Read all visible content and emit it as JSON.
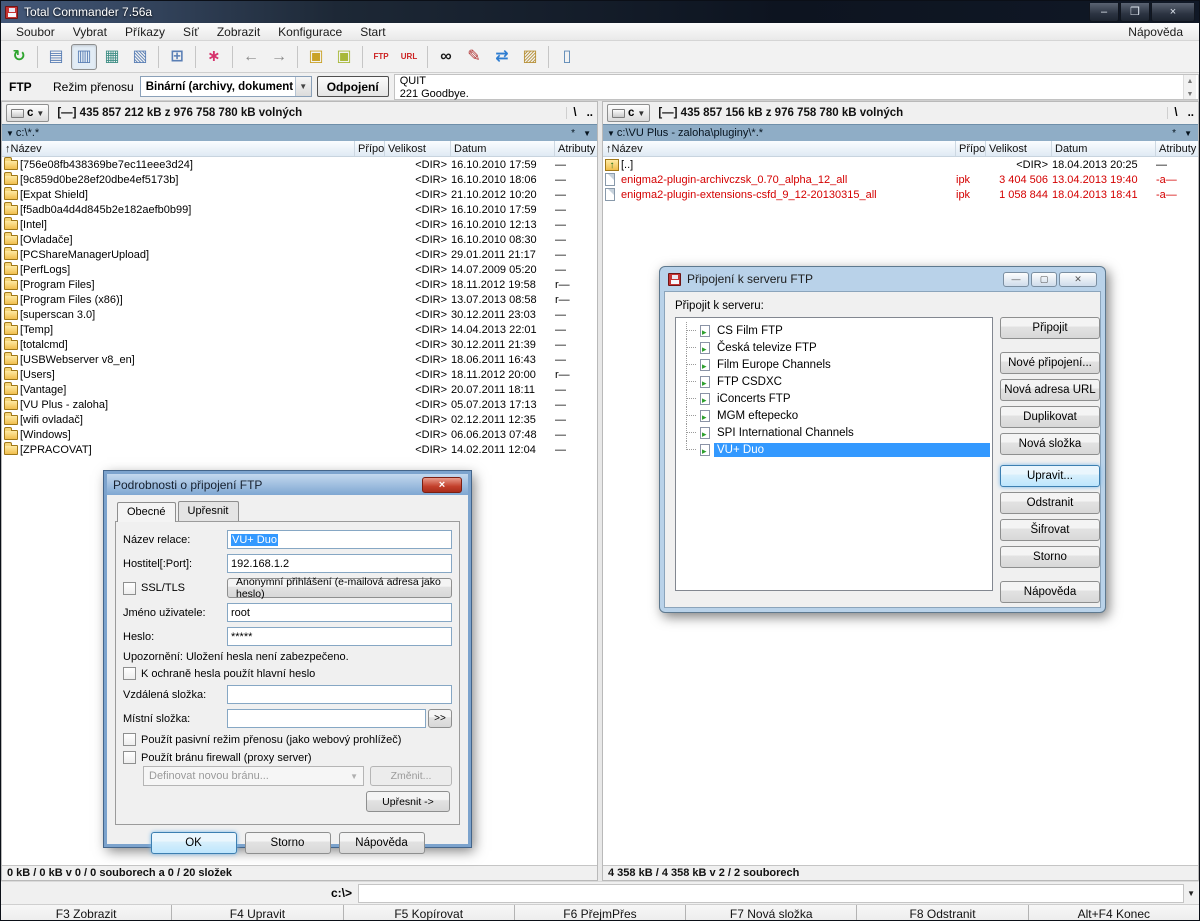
{
  "window": {
    "title": "Total Commander 7.56a"
  },
  "menu": {
    "items": [
      "Soubor",
      "Vybrat",
      "Příkazy",
      "Síť",
      "Zobrazit",
      "Konfigurace",
      "Start"
    ],
    "right_item": "Nápověda"
  },
  "toolbar": {
    "icons": [
      {
        "name": "refresh-icon",
        "glyph": "↻",
        "color": "#2ea52e"
      },
      {
        "name": "brief-view-icon",
        "glyph": "▤",
        "color": "#5a7fb5",
        "sep": true
      },
      {
        "name": "full-view-icon",
        "glyph": "▥",
        "color": "#5a7fb5",
        "pressed": true
      },
      {
        "name": "thumbnail-view-icon",
        "glyph": "▦",
        "color": "#3f8f86"
      },
      {
        "name": "tree-view-icon",
        "glyph": "▧",
        "color": "#5a7fb5"
      },
      {
        "name": "branch-view-icon",
        "glyph": "⊞",
        "color": "#5a7fb5",
        "sep": true
      },
      {
        "name": "select-group-icon",
        "glyph": "∗",
        "color": "#d6336c",
        "sep": true
      },
      {
        "name": "back-icon",
        "glyph": "←",
        "color": "#8a8a8a",
        "sep": true
      },
      {
        "name": "forward-icon",
        "glyph": "→",
        "color": "#8a8a8a"
      },
      {
        "name": "pack-icon",
        "glyph": "▣",
        "color": "#c9a227",
        "sep": true
      },
      {
        "name": "unpack-icon",
        "glyph": "▣",
        "color": "#a8b83a"
      },
      {
        "name": "ftp-connect-icon",
        "glyph": "FTP",
        "color": "#cc2222",
        "text": true,
        "sep": true
      },
      {
        "name": "ftp-url-icon",
        "glyph": "URL",
        "color": "#cc2222",
        "text": true
      },
      {
        "name": "search-icon",
        "glyph": "∞",
        "color": "#1a1a1a",
        "sep": true
      },
      {
        "name": "multi-rename-icon",
        "glyph": "✎",
        "color": "#b03030"
      },
      {
        "name": "sync-dirs-icon",
        "glyph": "⇄",
        "color": "#2e7dd1"
      },
      {
        "name": "clipboard-icon",
        "glyph": "▨",
        "color": "#b8923a"
      },
      {
        "name": "notepad-icon",
        "glyph": "▯",
        "color": "#5a87b5",
        "sep": true
      }
    ]
  },
  "ftp_bar": {
    "label": "FTP",
    "mode_label": "Režim přenosu",
    "mode_value": "Binární (archivy, dokument",
    "disconnect_label": "Odpojení",
    "log_line1": "QUIT",
    "log_line2": "221 Goodbye."
  },
  "left_panel": {
    "drive": "c",
    "free_space": "[—]  435 857 212 kB z 976 758 780 kB volných",
    "root_button": "\\",
    "up_button": "..",
    "path": "c:\\*.*",
    "filter": "*",
    "columns": [
      "↑Název",
      "Přípo",
      "Velikost",
      "Datum",
      "Atributy"
    ],
    "rows": [
      {
        "icon": "folder-icon",
        "name": "[756e08fb438369be7ec11eee3d24]",
        "ext": "",
        "size": "<DIR>",
        "date": "16.10.2010 17:59",
        "attr": "—"
      },
      {
        "icon": "folder-icon",
        "name": "[9c859d0be28ef20dbe4ef5173b]",
        "ext": "",
        "size": "<DIR>",
        "date": "16.10.2010 18:06",
        "attr": "—"
      },
      {
        "icon": "folder-icon",
        "name": "[Expat Shield]",
        "ext": "",
        "size": "<DIR>",
        "date": "21.10.2012 10:20",
        "attr": "—"
      },
      {
        "icon": "folder-icon",
        "name": "[f5adb0a4d4d845b2e182aefb0b99]",
        "ext": "",
        "size": "<DIR>",
        "date": "16.10.2010 17:59",
        "attr": "—"
      },
      {
        "icon": "folder-icon",
        "name": "[Intel]",
        "ext": "",
        "size": "<DIR>",
        "date": "16.10.2010 12:13",
        "attr": "—"
      },
      {
        "icon": "folder-icon",
        "name": "[Ovladače]",
        "ext": "",
        "size": "<DIR>",
        "date": "16.10.2010 08:30",
        "attr": "—"
      },
      {
        "icon": "folder-icon",
        "name": "[PCShareManagerUpload]",
        "ext": "",
        "size": "<DIR>",
        "date": "29.01.2011 21:17",
        "attr": "—"
      },
      {
        "icon": "folder-icon",
        "name": "[PerfLogs]",
        "ext": "",
        "size": "<DIR>",
        "date": "14.07.2009 05:20",
        "attr": "—"
      },
      {
        "icon": "folder-icon",
        "name": "[Program Files]",
        "ext": "",
        "size": "<DIR>",
        "date": "18.11.2012 19:58",
        "attr": "r—"
      },
      {
        "icon": "folder-icon",
        "name": "[Program Files (x86)]",
        "ext": "",
        "size": "<DIR>",
        "date": "13.07.2013 08:58",
        "attr": "r—"
      },
      {
        "icon": "folder-icon",
        "name": "[superscan 3.0]",
        "ext": "",
        "size": "<DIR>",
        "date": "30.12.2011 23:03",
        "attr": "—"
      },
      {
        "icon": "folder-icon",
        "name": "[Temp]",
        "ext": "",
        "size": "<DIR>",
        "date": "14.04.2013 22:01",
        "attr": "—"
      },
      {
        "icon": "folder-icon",
        "name": "[totalcmd]",
        "ext": "",
        "size": "<DIR>",
        "date": "30.12.2011 21:39",
        "attr": "—"
      },
      {
        "icon": "folder-icon",
        "name": "[USBWebserver v8_en]",
        "ext": "",
        "size": "<DIR>",
        "date": "18.06.2011 16:43",
        "attr": "—"
      },
      {
        "icon": "folder-icon",
        "name": "[Users]",
        "ext": "",
        "size": "<DIR>",
        "date": "18.11.2012 20:00",
        "attr": "r—"
      },
      {
        "icon": "folder-icon",
        "name": "[Vantage]",
        "ext": "",
        "size": "<DIR>",
        "date": "20.07.2011 18:11",
        "attr": "—"
      },
      {
        "icon": "folder-icon",
        "name": "[VU Plus - zaloha]",
        "ext": "",
        "size": "<DIR>",
        "date": "05.07.2013 17:13",
        "attr": "—"
      },
      {
        "icon": "folder-icon",
        "name": "[wifi ovladač]",
        "ext": "",
        "size": "<DIR>",
        "date": "02.12.2011 12:35",
        "attr": "—"
      },
      {
        "icon": "folder-icon",
        "name": "[Windows]",
        "ext": "",
        "size": "<DIR>",
        "date": "06.06.2013 07:48",
        "attr": "—"
      },
      {
        "icon": "folder-icon",
        "name": "[ZPRACOVAT]",
        "ext": "",
        "size": "<DIR>",
        "date": "14.02.2011 12:04",
        "attr": "—"
      }
    ],
    "status": "0 kB / 0 kB v 0 / 0 souborech a 0 / 20 složek"
  },
  "right_panel": {
    "drive": "c",
    "free_space": "[—]  435 857 156 kB z 976 758 780 kB volných",
    "root_button": "\\",
    "up_button": "..",
    "path": "c:\\VU Plus - zaloha\\pluginy\\*.*",
    "filter": "*",
    "columns": [
      "↑Název",
      "Přípo",
      "Velikost",
      "Datum",
      "Atributy"
    ],
    "rows": [
      {
        "icon": "up-dir-icon",
        "name": "[..]",
        "ext": "",
        "size": "<DIR>",
        "date": "18.04.2013 20:25",
        "attr": "—"
      },
      {
        "icon": "file-icon",
        "name": "enigma2-plugin-archivczsk_0.70_alpha_12_all",
        "ext": "ipk",
        "size": "3 404 506",
        "date": "13.04.2013 19:40",
        "attr": "-a—",
        "selected": true
      },
      {
        "icon": "file-icon",
        "name": "enigma2-plugin-extensions-csfd_9_12-20130315_all",
        "ext": "ipk",
        "size": "1 058 844",
        "date": "18.04.2013 18:41",
        "attr": "-a—",
        "selected": true
      }
    ],
    "status": "4 358 kB / 4 358 kB v 2 / 2 souborech"
  },
  "command_line": {
    "prompt": "c:\\>"
  },
  "fkeys": [
    "F3 Zobrazit",
    "F4 Upravit",
    "F5 Kopírovat",
    "F6 PřejmPřes",
    "F7 Nová složka",
    "F8 Odstranit",
    "Alt+F4 Konec"
  ],
  "ftp_dialog": {
    "title": "Připojení k serveru FTP",
    "label": "Připojit k serveru:",
    "servers": [
      {
        "label": "CS Film FTP"
      },
      {
        "label": "Česká televize FTP"
      },
      {
        "label": "Film Europe Channels"
      },
      {
        "label": "FTP CSDXC"
      },
      {
        "label": "iConcerts FTP"
      },
      {
        "label": "MGM eftepecko"
      },
      {
        "label": "SPI International Channels"
      },
      {
        "label": "VU+ Duo",
        "selected": true
      }
    ],
    "buttons": [
      {
        "label": "Připojit",
        "gap": "gap13"
      },
      {
        "label": "Nové připojení..."
      },
      {
        "label": "Nová adresa URL"
      },
      {
        "label": "Duplikovat"
      },
      {
        "label": "Nová složka",
        "gap": "gap10"
      },
      {
        "label": "Upravit...",
        "focused": true
      },
      {
        "label": "Odstranit"
      },
      {
        "label": "Šifrovat"
      },
      {
        "label": "Storno",
        "gap": "gap13"
      },
      {
        "label": "Nápověda"
      }
    ]
  },
  "details_dialog": {
    "title": "Podrobnosti o připojení FTP",
    "tab_general": "Obecné",
    "tab_advanced": "Upřesnit",
    "session_label": "Název relace:",
    "session_value": "VU+ Duo",
    "host_label": "Hostitel[:Port]:",
    "host_value": "192.168.1.2",
    "ssl_label": "SSL/TLS",
    "anonymous_button": "Anonymní přihlášení (e-mailová adresa jako heslo)",
    "user_label": "Jméno uživatele:",
    "user_value": "root",
    "password_label": "Heslo:",
    "password_value": "*****",
    "warning": "Upozornění: Uložení hesla není zabezpečeno.",
    "master_password_label": "K ochraně hesla použít hlavní heslo",
    "remote_dir_label": "Vzdálená složka:",
    "remote_dir_value": "",
    "local_dir_label": "Místní složka:",
    "local_dir_value": "",
    "browse_button": ">>",
    "passive_label": "Použít pasivní režim přenosu (jako webový prohlížeč)",
    "firewall_label": "Použít bránu firewall (proxy server)",
    "gateway_value": "Definovat novou bránu...",
    "change_button": "Změnit...",
    "advanced_button": "Upřesnit ->",
    "ok_button": "OK",
    "cancel_button": "Storno",
    "help_button": "Nápověda"
  },
  "colors": {
    "selection_blue": "#3399ff",
    "selected_file_red": "#d40000",
    "path_bar_blue": "#8fadc6"
  }
}
